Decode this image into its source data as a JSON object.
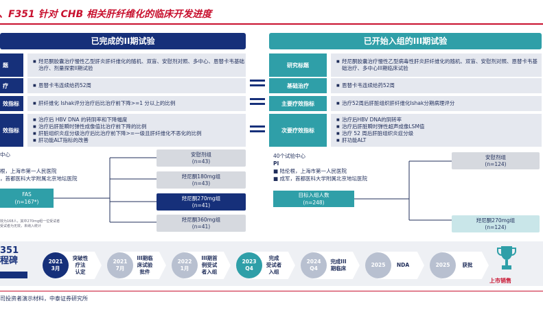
{
  "title": "、F351 针对 CHB 相关肝纤维化的临床开发进度",
  "left_header": "已完成的II期试验",
  "right_header": "已开始入组的III期试验",
  "left_rows": [
    {
      "label": "题",
      "items": [
        "羟尼酮胶囊治疗慢性乙型肝炎肝纤维化的随机、双盲、安慰剂对照、多中心、恩替卡韦基础治疗、剂量探索II期试验"
      ]
    },
    {
      "label": "疗",
      "items": [
        "恩替卡韦连续给药52周"
      ]
    },
    {
      "label": "效指标",
      "items": [
        "肝纤维化 Ishak评分治疗后比治疗前下降>=1 分以上的比例"
      ]
    },
    {
      "label": "效指标",
      "items": [
        "治疗后 HBV DNA 的转阴率和下降幅度",
        "治疗后肝脏瞬时弹性成像值比治疗前下降的比例",
        "肝脏组织炎症分级治疗后比治疗前下降>=一级且肝纤维化不恶化的比例",
        "肝功能ALT指标的改善"
      ]
    }
  ],
  "right_rows": [
    {
      "label": "研究标题",
      "items": [
        "羟尼酮胶囊治疗慢性乙型病毒性肝炎肝纤维化的随机、双盲、安慰剂对照、恩替卡韦基础治疗、多中心III期临床试验"
      ]
    },
    {
      "label": "基础治疗",
      "items": [
        "恩替卡韦连续给药52周"
      ]
    },
    {
      "label": "主要疗效指标",
      "items": [
        "治疗52周后肝脏组织肝纤维化Ishak分期病理评分"
      ]
    },
    {
      "label": "次要疗效指标",
      "items": [
        "治疗后HBV DNA的阴转率",
        "治疗后肝脏瞬时弹性超声成像LSM值",
        "治疗 52 周后肝脏组织炎症分级",
        "肝功能ALT"
      ]
    }
  ],
  "left_design": {
    "centers": "中心",
    "pis": [
      "根，上海市第一人民医院",
      "，首都医科大学附属北京地坛医院"
    ],
    "fas_label": "FAS",
    "fas_n": "(n=167*)",
    "footnote": [
      "效为168人，其中270mg组一位受试者",
      "受试者为无效，未纳入统计"
    ],
    "arms": [
      {
        "name": "安慰剂组",
        "n": "(n=43)"
      },
      {
        "name": "羟尼酮180mg组",
        "n": "(n=43)"
      },
      {
        "name": "羟尼酮270mg组",
        "n": "(n=41)"
      },
      {
        "name": "羟尼酮360mg组",
        "n": "(n=41)"
      }
    ]
  },
  "right_design": {
    "centers": "40个试验中心",
    "pi_label": "PI",
    "pis": [
      "陆伦根，上海市第一人民医院",
      "成军，首都医科大学附属北京地坛医院"
    ],
    "target_label": "目标入组人数",
    "target_n": "(n=248)",
    "arms": [
      {
        "name": "安慰剂组",
        "n": "(n=124)"
      },
      {
        "name": "羟尼酮270mg组",
        "n": "(n=124)"
      }
    ]
  },
  "milestone_label": [
    "351",
    "程碑"
  ],
  "milestones": [
    {
      "date": [
        "2021",
        "3月"
      ],
      "text": [
        "突破性",
        "疗法",
        "认定"
      ],
      "style": "navy"
    },
    {
      "date": [
        "2021",
        "7月"
      ],
      "text": [
        "III期临",
        "床试验",
        "批件"
      ],
      "style": "grey"
    },
    {
      "date": [
        "2022",
        "1月"
      ],
      "text": [
        "III期首",
        "例受试",
        "者入组"
      ],
      "style": "grey"
    },
    {
      "date": [
        "2023",
        "Q4"
      ],
      "text": [
        "完成",
        "受试者",
        "入组"
      ],
      "style": "teal"
    },
    {
      "date": [
        "2024",
        "Q4"
      ],
      "text": [
        "完成III",
        "期临床"
      ],
      "style": "grey"
    },
    {
      "date": [
        "2025",
        ""
      ],
      "text": [
        "NDA"
      ],
      "style": "grey"
    },
    {
      "date": [
        "2025",
        ""
      ],
      "text": [
        "获批"
      ],
      "style": "grey"
    }
  ],
  "final_label": "上市销售",
  "source": "司投资者演示材料，中泰证券研究所",
  "colors": {
    "red": "#c8102e",
    "navy": "#16307a",
    "teal": "#2f9fa8"
  }
}
